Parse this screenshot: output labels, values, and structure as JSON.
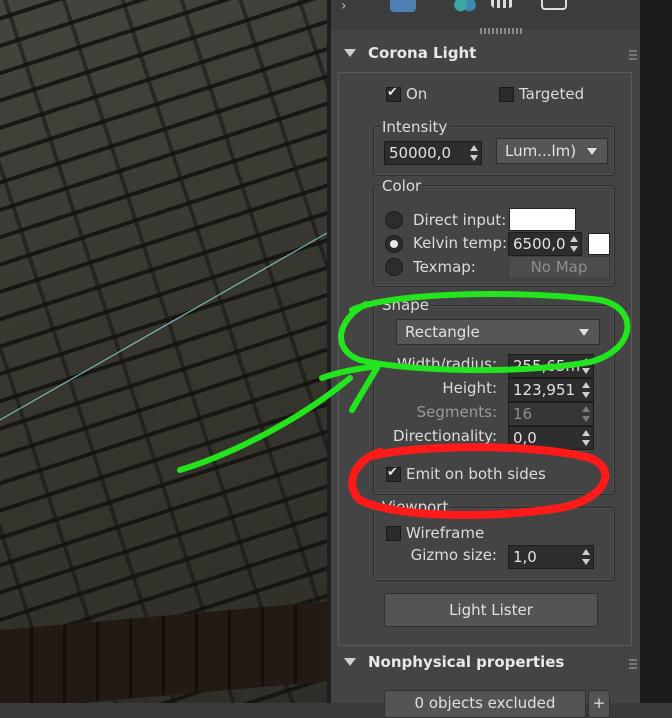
{
  "corona_light": {
    "title": "Corona Light",
    "on_label": "On",
    "on_checked": true,
    "targeted_label": "Targeted",
    "targeted_checked": false,
    "intensity": {
      "title": "Intensity",
      "value": "50000,0",
      "unit": "Lum...lm)"
    },
    "color": {
      "title": "Color",
      "direct_input_label": "Direct input:",
      "kelvin_label": "Kelvin temp:",
      "kelvin_value": "6500,0",
      "texmap_label": "Texmap:",
      "texmap_button": "No Map",
      "selected": "kelvin",
      "swatch_color": "#ffffff"
    },
    "shape": {
      "title": "Shape",
      "type": "Rectangle",
      "width_label": "Width/radius:",
      "width_value": "255,65m",
      "height_label": "Height:",
      "height_value": "123,951",
      "segments_label": "Segments:",
      "segments_value": "16",
      "directionality_label": "Directionality:",
      "directionality_value": "0,0",
      "emit_both_label": "Emit on both sides",
      "emit_both_checked": true
    },
    "viewport": {
      "title": "Viewport",
      "wireframe_label": "Wireframe",
      "wireframe_checked": false,
      "gizmo_label": "Gizmo size:",
      "gizmo_value": "1,0"
    },
    "light_lister_button": "Light Lister"
  },
  "nonphysical": {
    "title": "Nonphysical properties",
    "exclude_button": "0 objects excluded",
    "add_button": "+"
  },
  "annotations": {
    "green_color": "#22e51e",
    "red_color": "#ff1a1a"
  }
}
